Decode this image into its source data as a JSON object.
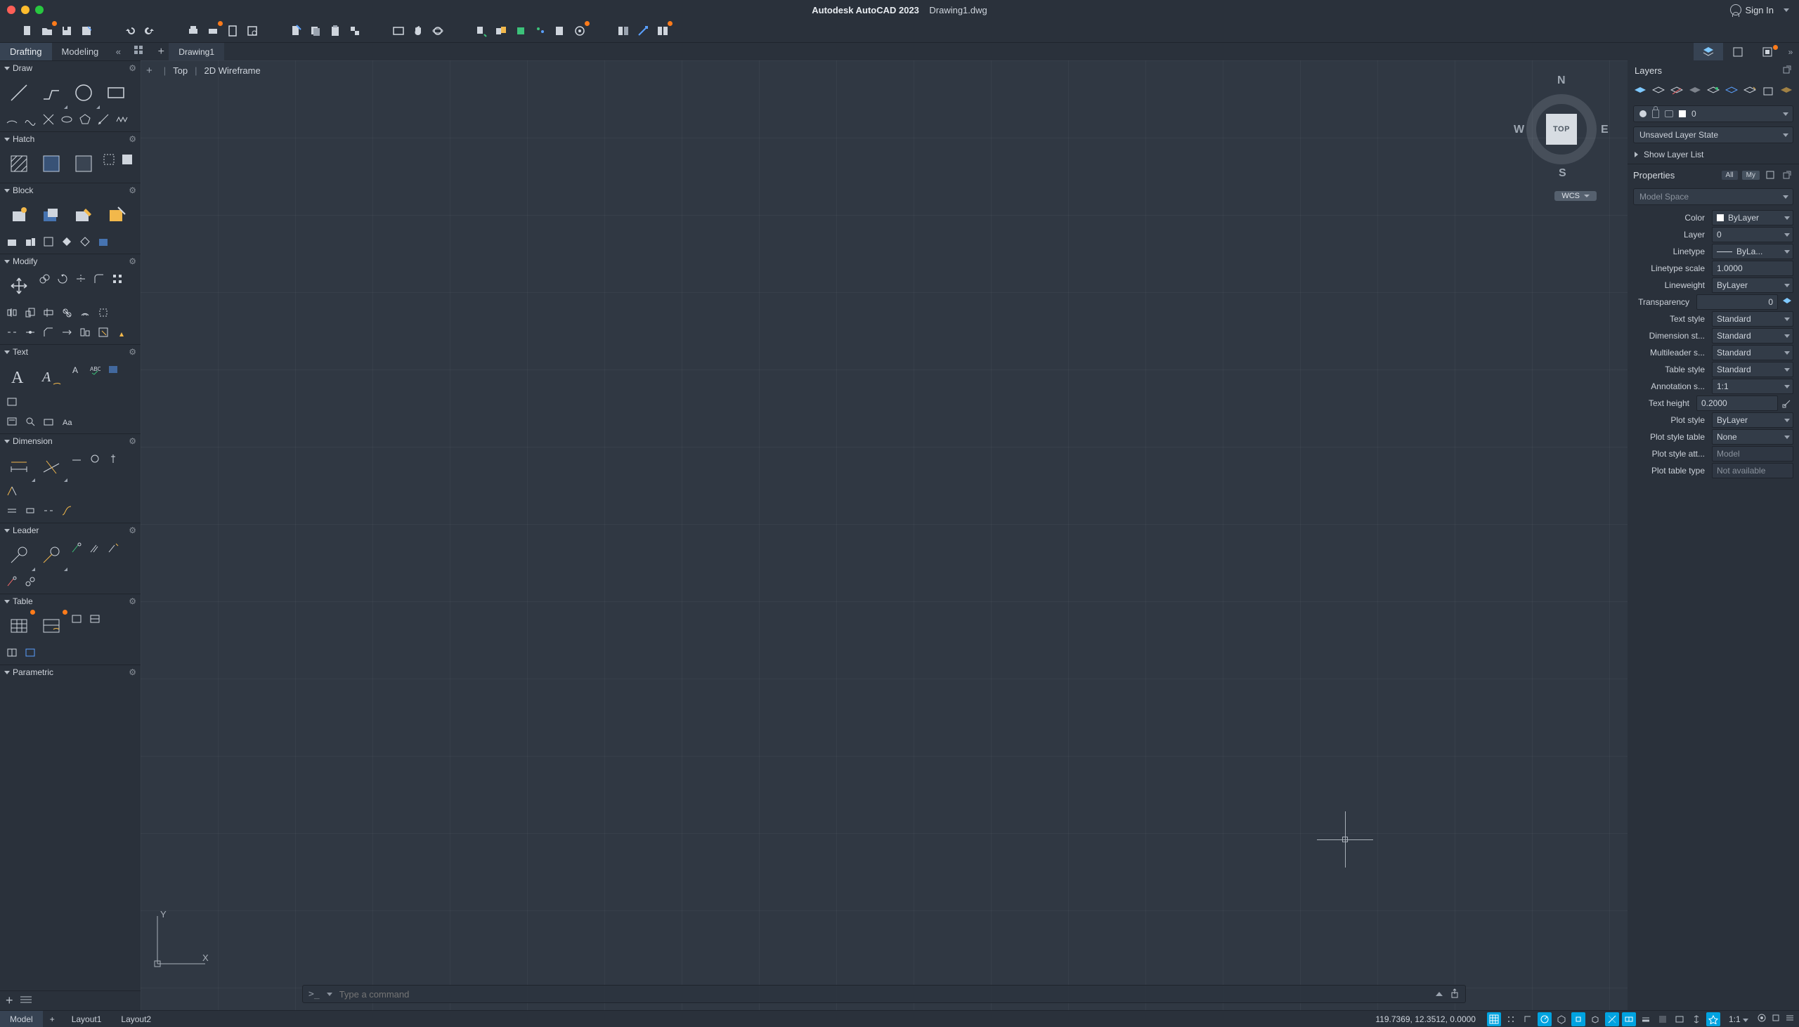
{
  "title": {
    "app": "Autodesk AutoCAD 2023",
    "file": "Drawing1.dwg"
  },
  "signin": "Sign In",
  "workspace_tabs": {
    "active": "Drafting",
    "other": "Modeling"
  },
  "doc_tab": "Drawing1",
  "right_tabs_badge_index": 2,
  "canvas": {
    "view_top": "Top",
    "view_style": "2D Wireframe",
    "viewcube_face": "TOP",
    "wcs": "WCS",
    "command_placeholder": "Type a command"
  },
  "sections": {
    "draw": "Draw",
    "hatch": "Hatch",
    "block": "Block",
    "modify": "Modify",
    "text": "Text",
    "dimension": "Dimension",
    "leader": "Leader",
    "table": "Table",
    "parametric": "Parametric"
  },
  "layers": {
    "title": "Layers",
    "current": "0",
    "state": "Unsaved Layer State",
    "showlist": "Show Layer List"
  },
  "properties": {
    "title": "Properties",
    "filter_all": "All",
    "filter_my": "My",
    "scope": "Model Space",
    "rows": {
      "color": {
        "label": "Color",
        "value": "ByLayer"
      },
      "layer": {
        "label": "Layer",
        "value": "0"
      },
      "linetype": {
        "label": "Linetype",
        "value": "ByLa..."
      },
      "ltscale": {
        "label": "Linetype scale",
        "value": "1.0000"
      },
      "lineweight": {
        "label": "Lineweight",
        "value": "ByLayer"
      },
      "transparency": {
        "label": "Transparency",
        "value": "0"
      },
      "textstyle": {
        "label": "Text style",
        "value": "Standard"
      },
      "dimstyle": {
        "label": "Dimension st...",
        "value": "Standard"
      },
      "mleader": {
        "label": "Multileader s...",
        "value": "Standard"
      },
      "tablestyle": {
        "label": "Table style",
        "value": "Standard"
      },
      "annoscale": {
        "label": "Annotation s...",
        "value": "1:1"
      },
      "textheight": {
        "label": "Text height",
        "value": "0.2000"
      },
      "plotstyle": {
        "label": "Plot style",
        "value": "ByLayer"
      },
      "plottable": {
        "label": "Plot style table",
        "value": "None"
      },
      "plotatt": {
        "label": "Plot style att...",
        "value": "Model"
      },
      "plottype": {
        "label": "Plot table type",
        "value": "Not available"
      }
    }
  },
  "status": {
    "model": "Model",
    "layout1": "Layout1",
    "layout2": "Layout2",
    "coords": "119.7369, 12.3512, 0.0000",
    "scale": "1:1"
  }
}
